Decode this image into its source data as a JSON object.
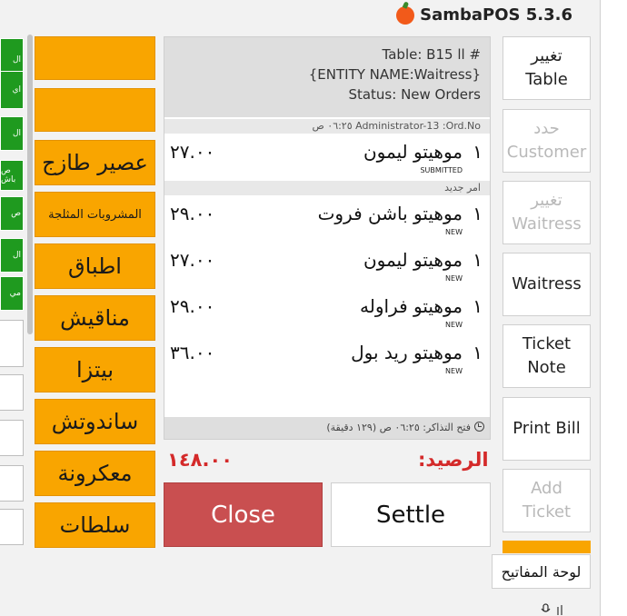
{
  "app": {
    "title": "SambaPOS 5.3.6"
  },
  "left_panel": {
    "green_buttons": [
      "ال",
      "اي",
      "ال",
      "ص\nباش",
      "ص",
      "ال",
      "مي"
    ]
  },
  "categories": [
    {
      "label": ""
    },
    {
      "label": ""
    },
    {
      "label": "عصير طازج"
    },
    {
      "label": "المشروبات المثلجة"
    },
    {
      "label": "اطباق"
    },
    {
      "label": "مناقيش"
    },
    {
      "label": "بيتزا"
    },
    {
      "label": "ساندوتش"
    },
    {
      "label": "معكرونة"
    },
    {
      "label": "سلطات"
    }
  ],
  "ticket": {
    "header": {
      "table_line": "Table: B15 اا #",
      "entity_line": "{ENTITY NAME:Waitress}",
      "status_line": "Status: New Orders"
    },
    "order_info": "٠٦:٢٥ ص Administrator-13 :Ord.No",
    "new_order_label": "امر جديد",
    "orders": [
      {
        "qty": "١",
        "name": "موهيتو ليمون",
        "price": "٢٧.٠٠",
        "state": "SUBMITTED"
      },
      {
        "qty": "١",
        "name": "موهيتو باشن فروت",
        "price": "٢٩.٠٠",
        "state": "NEW"
      },
      {
        "qty": "١",
        "name": "موهيتو ليمون",
        "price": "٢٧.٠٠",
        "state": "NEW"
      },
      {
        "qty": "١",
        "name": "موهيتو فراوله",
        "price": "٢٩.٠٠",
        "state": "NEW"
      },
      {
        "qty": "١",
        "name": "موهيتو ريد بول",
        "price": "٣٦.٠٠",
        "state": "NEW"
      }
    ],
    "footer": "فتح التذاكر: ٠٦:٢٥ ص (١٢٩ دقيقة)"
  },
  "balance": {
    "label": "الرصيد:",
    "amount": "١٤٨.٠٠",
    "color": "#d42a2a"
  },
  "actions": {
    "close": "Close",
    "settle": "Settle"
  },
  "commands": [
    {
      "label": "تغيير\nTable",
      "enabled": true
    },
    {
      "label": "حدد\nCustomer",
      "enabled": false
    },
    {
      "label": "تغيير\nWaitress",
      "enabled": false
    },
    {
      "label": "Waitress",
      "enabled": true
    },
    {
      "label": "Ticket\nNote",
      "enabled": true
    },
    {
      "label": "Print Bill",
      "enabled": true
    },
    {
      "label": "Add\nTicket",
      "enabled": false
    }
  ],
  "keyboard_button": "لوحة المفاتيح",
  "colors": {
    "category": "#f9a500",
    "close": "#c94f50",
    "green": "#1f9a1f"
  },
  "icons": {
    "logo": "tomato-icon",
    "clock": "clock-icon",
    "mic": "microphone-icon"
  }
}
